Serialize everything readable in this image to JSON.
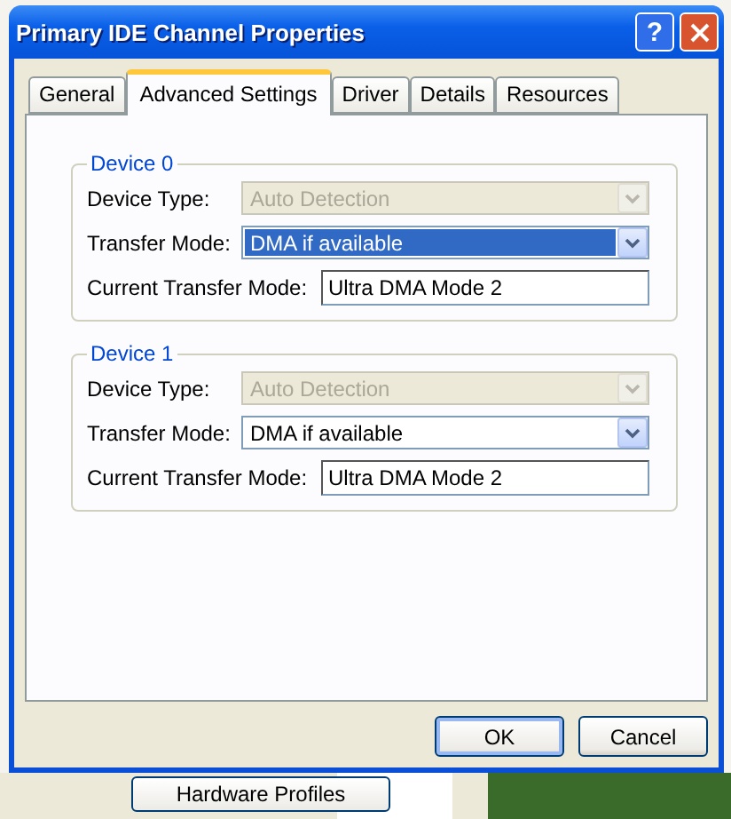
{
  "window": {
    "title": "Primary IDE Channel Properties",
    "help_label": "?"
  },
  "tabs": [
    {
      "label": "General",
      "selected": false
    },
    {
      "label": "Advanced Settings",
      "selected": true
    },
    {
      "label": "Driver",
      "selected": false
    },
    {
      "label": "Details",
      "selected": false
    },
    {
      "label": "Resources",
      "selected": false
    }
  ],
  "devices": [
    {
      "title": "Device 0",
      "device_type": {
        "label": "Device Type:",
        "value": "Auto Detection",
        "disabled": true
      },
      "transfer_mode": {
        "label": "Transfer Mode:",
        "value": "DMA if available",
        "disabled": false,
        "highlighted": true
      },
      "current_mode": {
        "label": "Current Transfer Mode:",
        "value": "Ultra DMA Mode 2"
      }
    },
    {
      "title": "Device 1",
      "device_type": {
        "label": "Device Type:",
        "value": "Auto Detection",
        "disabled": true
      },
      "transfer_mode": {
        "label": "Transfer Mode:",
        "value": "DMA if available",
        "disabled": false,
        "highlighted": false
      },
      "current_mode": {
        "label": "Current Transfer Mode:",
        "value": "Ultra DMA Mode 2"
      }
    }
  ],
  "buttons": [
    {
      "label": "OK",
      "default": true
    },
    {
      "label": "Cancel",
      "default": false
    }
  ],
  "background": {
    "button": "Hardware Profiles"
  }
}
